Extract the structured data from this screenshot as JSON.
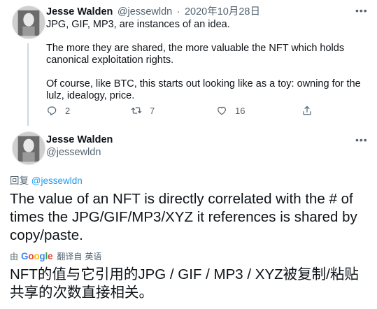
{
  "tweet1": {
    "author_name": "Jesse Walden",
    "author_handle": "@jessewldn",
    "separator": "·",
    "date": "2020年10月28日",
    "more_label": "•••",
    "paragraphs": [
      "JPG, GIF, MP3, are instances of an idea.",
      "The more they are shared, the more valuable the NFT which holds canonical exploitation rights.",
      "Of course, like BTC, this starts out looking like as a toy: owning for the lulz, idealogy, price."
    ],
    "actions": {
      "reply_icon": "reply-icon",
      "reply_count": "2",
      "retweet_icon": "retweet-icon",
      "retweet_count": "7",
      "like_icon": "heart-icon",
      "like_count": "16",
      "share_icon": "share-icon"
    }
  },
  "tweet2": {
    "author_name": "Jesse Walden",
    "author_handle": "@jessewldn",
    "more_label": "•••",
    "reply_prefix": "回复",
    "reply_handle": "@jessewldn",
    "text": "The value of an NFT is directly correlated with the # of times the JPG/GIF/MP3/XYZ it references is shared by copy/paste.",
    "translation": {
      "by_label": "由",
      "google_letters": [
        "G",
        "o",
        "o",
        "g",
        "l",
        "e"
      ],
      "google_colors": [
        "#4285f4",
        "#ea4335",
        "#fbbc05",
        "#4285f4",
        "#34a853",
        "#ea4335"
      ],
      "from_label": "翻译自",
      "language": "英语",
      "translated_text": "NFT的值与它引用的JPG / GIF / MP3 / XYZ被复制/粘贴共享的次数直接相关。"
    }
  }
}
